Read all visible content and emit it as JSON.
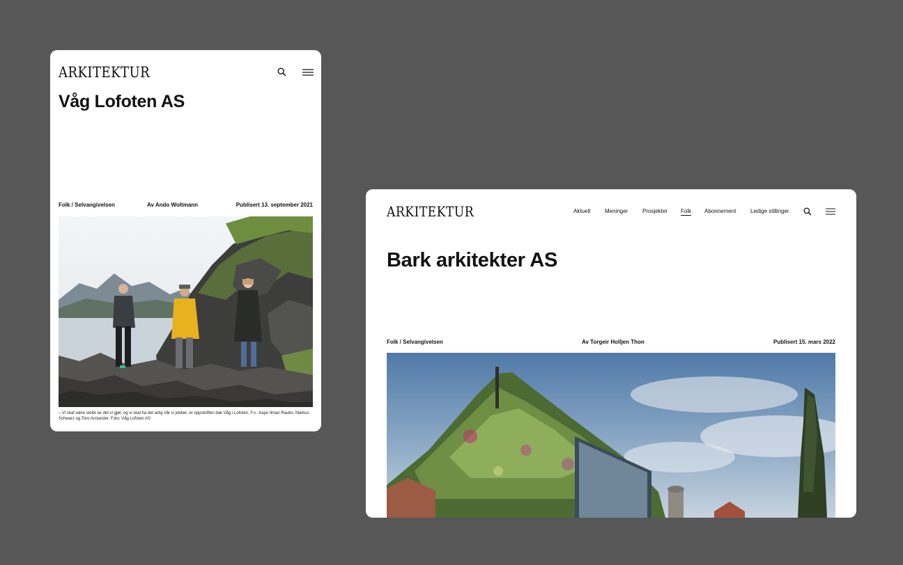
{
  "mobile": {
    "logo": "ARKITEKTUR",
    "title": "Våg Lofoten AS",
    "category": "Folk / Selvangivelsen",
    "author": "Av Ando Woltmann",
    "published": "Publisert 13. september 2021",
    "caption": "– Vi skal være stolte av det vi gjør, og vi skal ha det artig når vi jobber, er oppskriften bak Våg i Lofoten. F.v.: Aapo Ilmari Rautio, Markus Schwarz og Toro Arctander. Foto: Våg Lofoten AS",
    "icons": [
      "search-icon",
      "menu-icon"
    ]
  },
  "desktop": {
    "logo": "ARKITEKTUR",
    "nav": [
      "Aktuelt",
      "Meninger",
      "Prosjekter",
      "Folk",
      "Abonnement",
      "Ledige stillinger"
    ],
    "active_nav": "Folk",
    "title": "Bark arkitekter AS",
    "category": "Folk / Selvangivelsen",
    "author": "Av Torgeir Holljen Thon",
    "published": "Publisert 15. mars 2022",
    "icons": [
      "search-icon",
      "menu-icon"
    ]
  },
  "colors": {
    "background": "#575757",
    "card": "#ffffff",
    "text": "#111111"
  }
}
